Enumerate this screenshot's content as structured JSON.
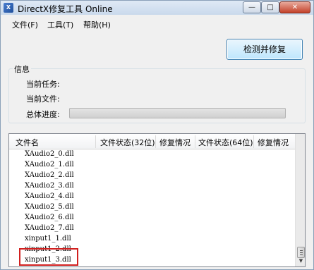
{
  "window": {
    "title": "DirectX修复工具 Online",
    "minimize_glyph": "—",
    "maximize_glyph": "□",
    "close_glyph": "✕"
  },
  "menu": {
    "file": "文件(F)",
    "tools": "工具(T)",
    "help": "帮助(H)"
  },
  "toolbar": {
    "repair_button": "检测并修复"
  },
  "info": {
    "group_title": "信息",
    "current_task_label": "当前任务:",
    "current_file_label": "当前文件:",
    "overall_progress_label": "总体进度:",
    "progress": 0
  },
  "list": {
    "columns": [
      "文件名",
      "文件状态(32位)",
      "修复情况",
      "文件状态(64位)",
      "修复情况"
    ],
    "rows": [
      "XAudio2_0.dll",
      "XAudio2_1.dll",
      "XAudio2_2.dll",
      "XAudio2_3.dll",
      "XAudio2_4.dll",
      "XAudio2_5.dll",
      "XAudio2_6.dll",
      "XAudio2_7.dll",
      "xinput1_1.dll",
      "xinput1_2.dll",
      "xinput1_3.dll"
    ],
    "highlighted_row": "xinput1_3.dll"
  },
  "colors": {
    "highlight": "#d1201f",
    "progress_fill": "#06b025"
  },
  "icons": {
    "app": "directx-app-icon",
    "scroll_down": "scroll-down-arrow-icon"
  }
}
